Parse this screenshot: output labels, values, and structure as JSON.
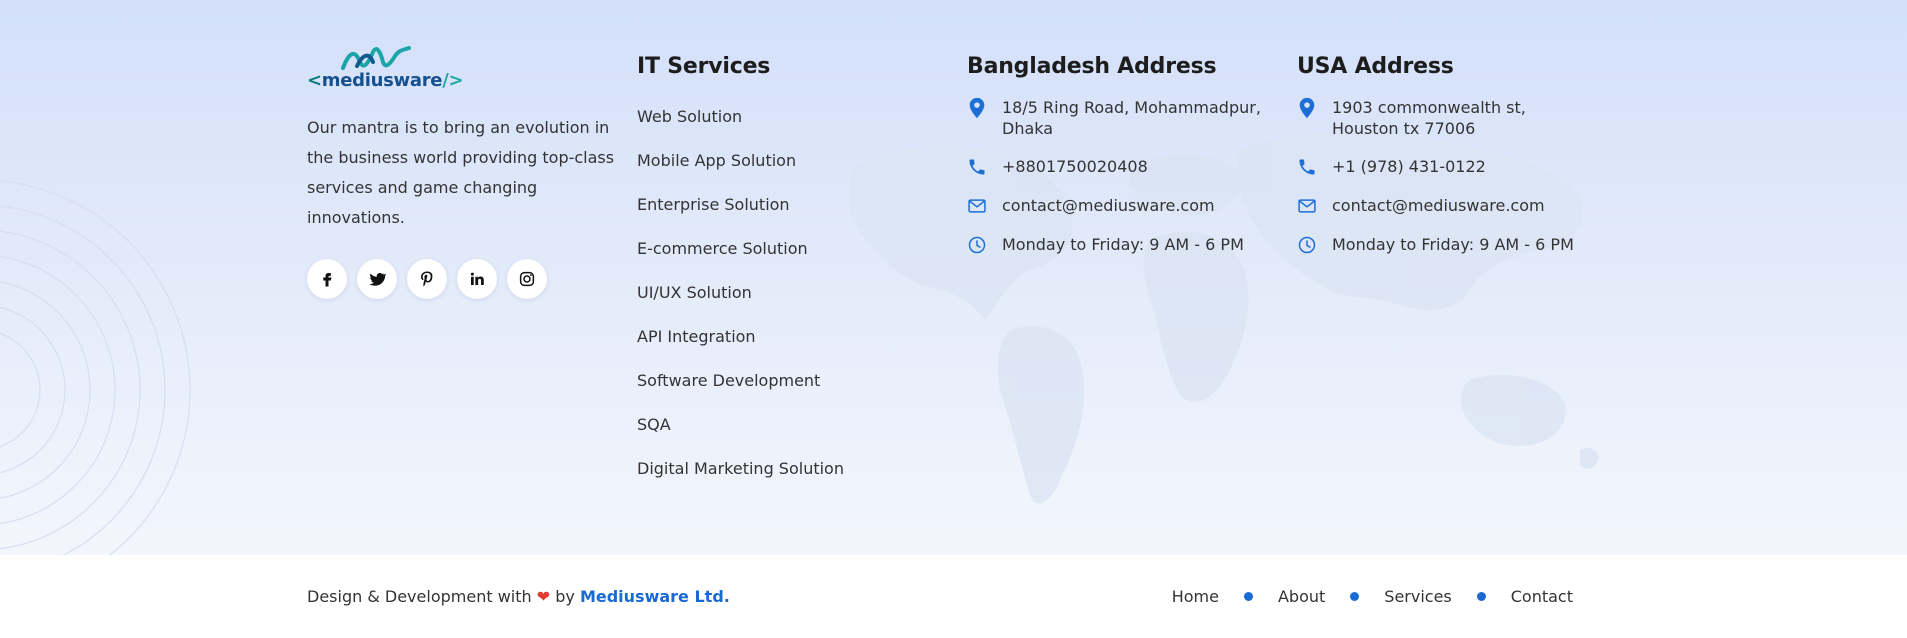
{
  "brand": {
    "logo_text_lt": "<",
    "logo_text_name": "mediusware",
    "logo_text_gt": "/>",
    "mantra": "Our mantra is to bring an evolution in the business world providing top-class services and game changing innovations."
  },
  "socials": [
    "facebook",
    "twitter",
    "pinterest",
    "linkedin",
    "instagram"
  ],
  "services": {
    "title": "IT Services",
    "items": [
      "Web Solution",
      "Mobile App Solution",
      "Enterprise Solution",
      "E-commerce Solution",
      "UI/UX Solution",
      "API Integration",
      "Software Development",
      "SQA",
      "Digital Marketing Solution"
    ]
  },
  "bd_address": {
    "title": "Bangladesh Address",
    "address": "18/5 Ring Road, Mohammadpur, Dhaka",
    "phone": "+8801750020408",
    "email": "contact@mediusware.com",
    "hours": "Monday to Friday: 9 AM - 6 PM"
  },
  "usa_address": {
    "title": "USA Address",
    "address": "1903 commonwealth st, Houston tx 77006",
    "phone": "+1 (978) 431-0122",
    "email": "contact@mediusware.com",
    "hours": "Monday to Friday: 9 AM - 6 PM"
  },
  "bottom": {
    "credit_prefix": "Design & Development with",
    "heart": "❤",
    "credit_by": "by",
    "company": "Mediusware Ltd.",
    "nav": [
      "Home",
      "About",
      "Services",
      "Contact"
    ]
  },
  "colors": {
    "accent": "#1a6ad3",
    "icon_blue": "#1d6fd6",
    "heart": "#e53935",
    "bg_top": "#d3e0fa",
    "bg_bottom": "#f3f6fc"
  },
  "icons": {
    "address": "map-pin-icon",
    "phone": "phone-icon",
    "email": "envelope-icon",
    "hours": "clock-icon"
  }
}
